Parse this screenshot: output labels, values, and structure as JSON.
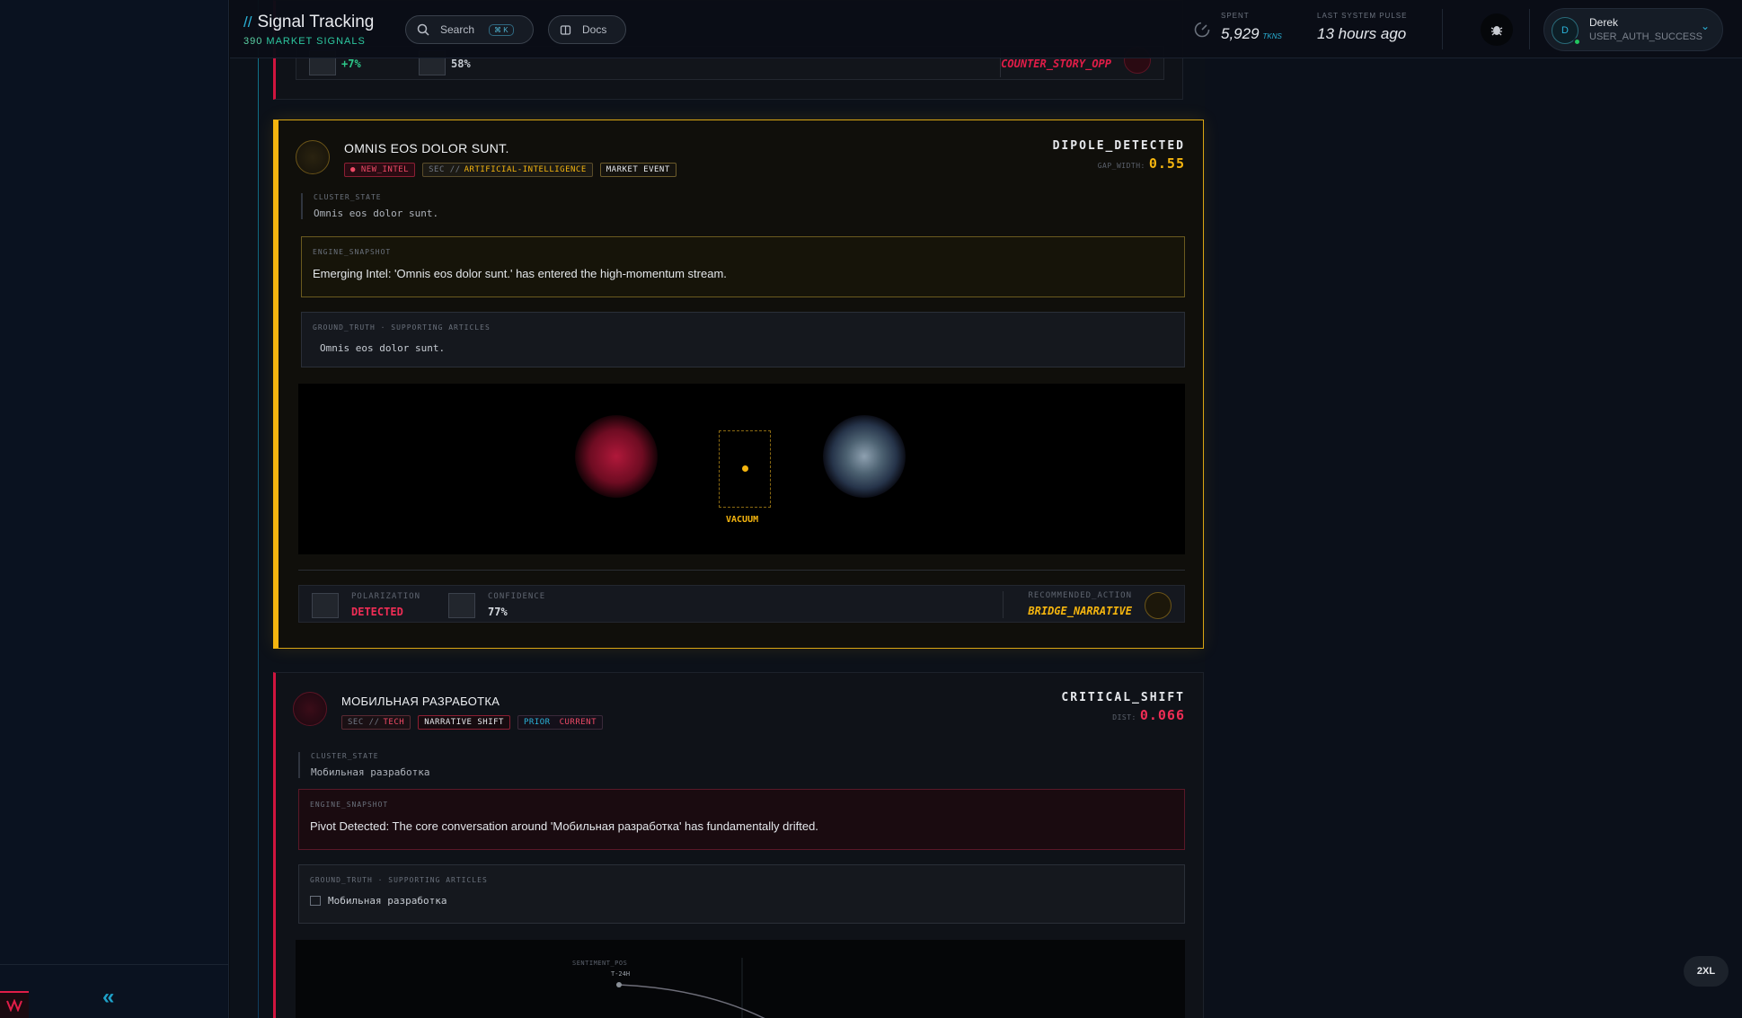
{
  "header": {
    "slashes": "//",
    "title": "Signal Tracking",
    "count": "390",
    "subtitle": "MARKET SIGNALS",
    "search_label": "Search",
    "search_kbd": "⌘ K",
    "docs_label": "Docs",
    "spent_label": "SPENT",
    "spent_value": "5,929",
    "spent_unit": "TKNS",
    "pulse_label": "LAST SYSTEM PULSE",
    "pulse_value": "13 hours ago"
  },
  "user": {
    "initial": "D",
    "name": "Derek",
    "status": "USER_AUTH_SUCCESS"
  },
  "prev_card": {
    "metric_a": "+7%",
    "metric_b": "58%",
    "action": "COUNTER_STORY_OPP"
  },
  "card1": {
    "title": "OMNIS EOS DOLOR SUNT.",
    "tag_new": "● NEW_INTEL",
    "tag_sector_prefix": "SEC //",
    "tag_sector": "ARTIFICIAL-INTELLIGENCE",
    "tag_event": "MARKET EVENT",
    "kind": "DIPOLE_DETECTED",
    "metric_label": "GAP_WIDTH:",
    "metric_value": "0.55",
    "cluster_label": "CLUSTER_STATE",
    "cluster_value": "Omnis eos dolor sunt.",
    "engine_label": "ENGINE_SNAPSHOT",
    "engine_text": "Emerging Intel: 'Omnis eos dolor sunt.' has entered the high-momentum stream.",
    "ground_label": "GROUND_TRUTH · SUPPORTING ARTICLES",
    "ground_item": "Omnis eos dolor sunt.",
    "vacuum_label": "VACUUM",
    "polarization_label": "POLARIZATION",
    "polarization_value": "DETECTED",
    "confidence_label": "CONFIDENCE",
    "confidence_value": "77%",
    "action_label": "RECOMMENDED_ACTION",
    "action_value": "BRIDGE_NARRATIVE"
  },
  "card2": {
    "title": "МОБИЛЬНАЯ РАЗРАБОТКА",
    "tag_sector_prefix": "SEC //",
    "tag_sector": "TECH",
    "tag_shift": "NARRATIVE SHIFT",
    "tag_prior": "PRIOR",
    "tag_current": "CURRENT",
    "kind": "CRITICAL_SHIFT",
    "metric_label": "DIST:",
    "metric_value": "0.066",
    "cluster_label": "CLUSTER_STATE",
    "cluster_value": "Мобильная разработка",
    "engine_label": "ENGINE_SNAPSHOT",
    "engine_text": "Pivot Detected: The core conversation around 'Мобильная разработка' has fundamentally drifted.",
    "ground_label": "GROUND_TRUTH · SUPPORTING ARTICLES",
    "ground_item": "Мобильная разработка",
    "chart_label": "SENTIMENT_POS",
    "chart_point": "T-24H"
  },
  "badge": "2XL",
  "colors": {
    "accent": "#2ab3d9",
    "gold": "#f5b50f",
    "critical": "#e11d48",
    "ok": "#22c55e"
  }
}
